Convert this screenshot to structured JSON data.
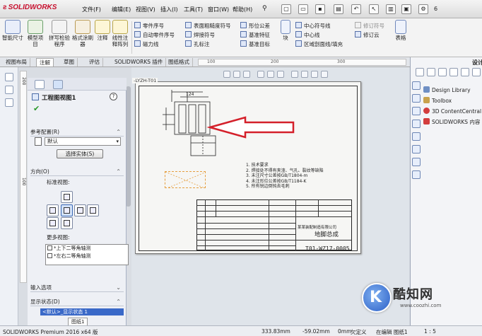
{
  "app": {
    "brand": "SOLIDWORKS",
    "menus": [
      "文件(F)",
      "编辑(E)",
      "视图(V)",
      "插入(I)",
      "工具(T)",
      "窗口(W)",
      "帮助(H)"
    ],
    "toolbar_trailing": "6"
  },
  "commands": {
    "big": [
      "智能尺寸",
      "模型项目",
      "拼写检验程序",
      "格式涂刷器",
      "注释",
      "线性注释阵列"
    ],
    "group1": [
      "零件序号",
      "自动零件序号",
      "磁力线"
    ],
    "group2": [
      "表面粗糙度符号",
      "焊接符号",
      "孔标注"
    ],
    "group3": [
      "形位公差",
      "基准特征",
      "基准目标"
    ],
    "block": "块",
    "group4": [
      "中心符号线",
      "中心线",
      "区域剖面线/填充"
    ],
    "revision": [
      "修订符号",
      "修订云"
    ],
    "table": "表格"
  },
  "tabs": [
    "视图布局",
    "注解",
    "草图",
    "评估",
    "SOLIDWORKS 插件",
    "图纸格式"
  ],
  "ruler": {
    "ticks": [
      "100",
      "200",
      "300"
    ]
  },
  "ruler_v": {
    "ticks": [
      "200",
      "100"
    ]
  },
  "property_manager": {
    "title": "工程图视图1",
    "help": "?",
    "groups": {
      "ref_config": "参考配置(R)",
      "orientation": "方向(O)",
      "standard_views": "标准视图:",
      "more_views": "更多视图:",
      "import_options": "输入选项",
      "display_state": "显示状态(D)"
    },
    "ref_config_value": "默认",
    "select_entity": "选择实体(S)",
    "more_views_items": [
      "*上下二等角轴测",
      "*左右二等角轴测"
    ],
    "display_state_value": "<默认>_显示状态 1"
  },
  "drawing": {
    "sheet_label": "-LYZH-T01",
    "dim_top": "124",
    "notes": [
      "1. 技术要求",
      "2. 焊接处不得有夹渣、气孔、裂纹等缺陷",
      "3. 未注尺寸公差按GB/T1804-m",
      "4. 未注形位公差按GB/T1184-K",
      "5. 所有锐边倒钝去毛刺"
    ],
    "titleblock": {
      "drawing_name": "地脚总成",
      "drawing_no": "T01-WZ17-0005",
      "company": "某某装配制造有限公司"
    }
  },
  "task_pane": {
    "title": "设计库",
    "items": [
      "Design Library",
      "Toolbox",
      "3D ContentCentral",
      "SOLIDWORKS 内容"
    ]
  },
  "sheet_tabs": [
    "图纸1"
  ],
  "status": {
    "product": "SOLIDWORKS Premium 2016 x64 版",
    "x": "333.83mm",
    "y": "-59.02mm",
    "z": "0mm",
    "state": "欠定义",
    "editing": "在编辑 图纸1",
    "scale": "1 : 5"
  },
  "watermark": {
    "title": "酷知网",
    "url": "www.coozhi.com",
    "glyph": "K"
  }
}
